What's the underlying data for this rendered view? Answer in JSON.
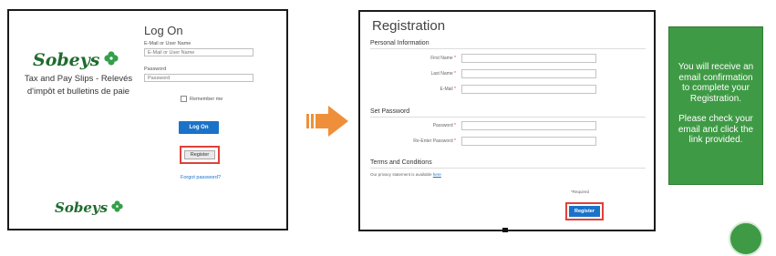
{
  "logon": {
    "brand": "Sobeys",
    "tagline": "Tax and Pay Slips - Relevés d'impôt et bulletins de paie",
    "title": "Log On",
    "email_label": "E-Mail or User Name",
    "email_placeholder": "E-Mail or User Name",
    "password_label": "Password",
    "password_placeholder": "Password",
    "remember_label": "Remember me",
    "logon_button": "Log On",
    "register_button": "Register",
    "forgot_link": "Forgot password?"
  },
  "registration": {
    "title": "Registration",
    "personal_section": "Personal Information",
    "first_name_label": "First Name",
    "last_name_label": "Last Name",
    "email_label": "E-Mail",
    "password_section": "Set Password",
    "password_label": "Password",
    "reenter_password_label": "Re-Enter Password",
    "required_mark": "*",
    "terms_section": "Terms and Conditions",
    "privacy_text": "Our privacy statement is available",
    "privacy_link": "here",
    "required_note": "*Required",
    "register_button": "Register"
  },
  "info": {
    "message_1": "You will receive an email confirmation to complete your Registration.",
    "message_2": "Please check your email  and click the link provided."
  },
  "colors": {
    "brand_green": "#1f6b2e",
    "accent_blue": "#1a73c8",
    "highlight_red": "#e0413a",
    "arrow_orange": "#ef8f3a",
    "info_green": "#3f9a45"
  }
}
